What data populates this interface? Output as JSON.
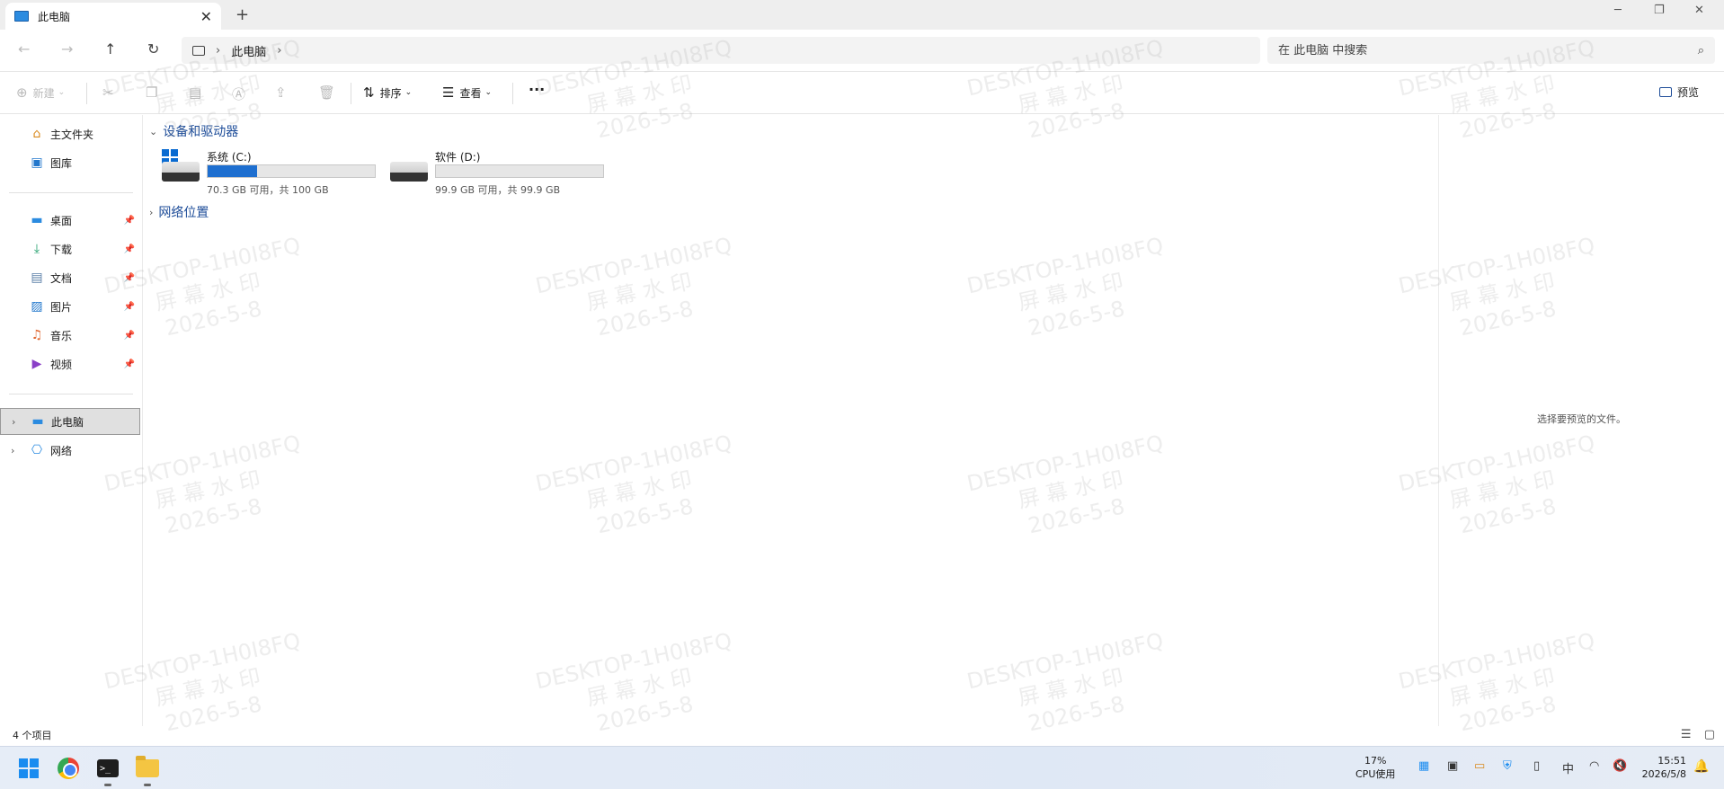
{
  "window": {
    "tab_title": "此电脑",
    "close_glyph": "✕",
    "newtab_glyph": "+"
  },
  "address": {
    "path": "此电脑",
    "search_placeholder": "在 此电脑 中搜索"
  },
  "commandbar": {
    "new_label": "新建",
    "sort_label": "排序",
    "view_label": "查看",
    "more_label": "···",
    "preview_label": "预览"
  },
  "sidebar": {
    "quick": [
      {
        "label": "主文件夹",
        "icon": "home-icon"
      },
      {
        "label": "图库",
        "icon": "gallery-icon"
      }
    ],
    "pinned": [
      {
        "label": "桌面",
        "icon": "desktop-icon"
      },
      {
        "label": "下载",
        "icon": "download-icon"
      },
      {
        "label": "文档",
        "icon": "document-icon"
      },
      {
        "label": "图片",
        "icon": "pictures-icon"
      },
      {
        "label": "音乐",
        "icon": "music-icon"
      },
      {
        "label": "视频",
        "icon": "video-icon"
      }
    ],
    "tree": [
      {
        "label": "此电脑",
        "icon": "pc-icon",
        "selected": true
      },
      {
        "label": "网络",
        "icon": "network-icon",
        "selected": false
      }
    ]
  },
  "content": {
    "devices_header": "设备和驱动器",
    "network_header": "网络位置",
    "drives": [
      {
        "name": "系统 (C:)",
        "info": "70.3 GB 可用，共 100 GB",
        "used_fraction": 0.297,
        "system": true
      },
      {
        "name": "软件 (D:)",
        "info": "99.9 GB 可用，共 99.9 GB",
        "used_fraction": 0.0,
        "system": false
      }
    ]
  },
  "preview": {
    "empty_text": "选择要预览的文件。"
  },
  "status": {
    "item_count": "4 个项目"
  },
  "taskbar": {
    "cpu_percent": "17%",
    "cpu_label": "CPU使用",
    "time": "15:51",
    "date": "2026/5/8",
    "ime": "中"
  },
  "watermark": {
    "line1": "DESKTOP-1H0I8FQ",
    "line2": "屏 幕 水 印",
    "line3": "2026-5-8"
  },
  "colors": {
    "accent": "#1e6fd0",
    "link": "#1e4d99"
  }
}
